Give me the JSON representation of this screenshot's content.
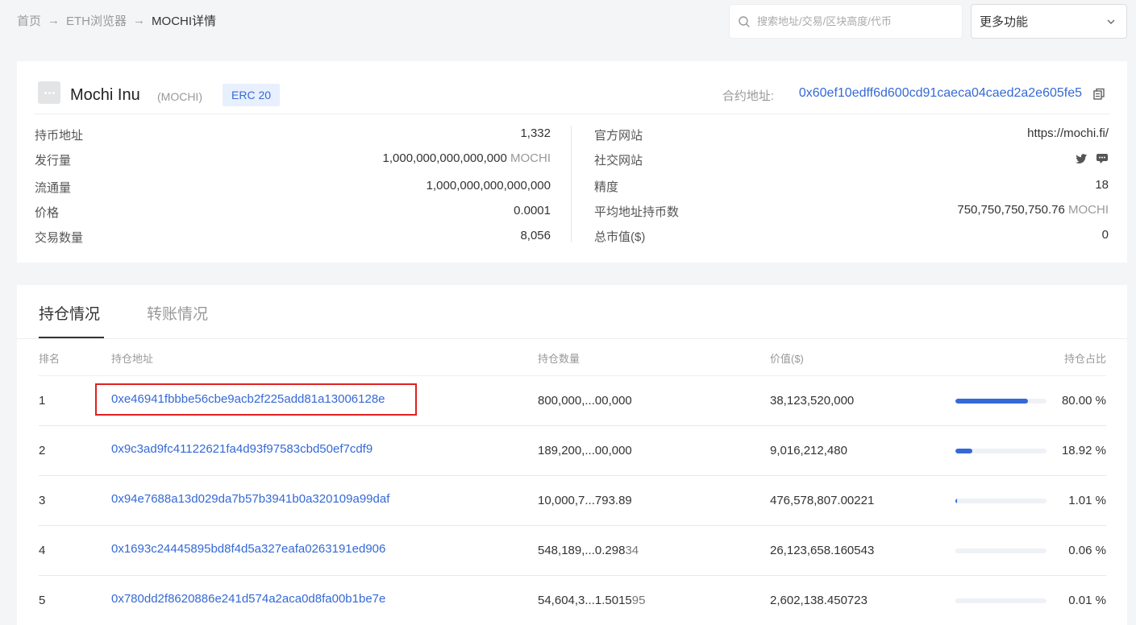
{
  "breadcrumb": {
    "home": "首页",
    "sep": "→",
    "explorer": "ETH浏览器",
    "current": "MOCHI详情"
  },
  "search": {
    "placeholder": "搜索地址/交易/区块高度/代币"
  },
  "more": {
    "label": "更多功能"
  },
  "token": {
    "name": "Mochi Inu",
    "symbol": "(MOCHI)",
    "standard": "ERC 20",
    "contract_label": "合约地址:",
    "contract_address": "0x60ef10edff6d600cd91caeca04caed2a2e605fe5"
  },
  "left_info": [
    {
      "label": "持币地址",
      "value": "1,332",
      "unit": ""
    },
    {
      "label": "发行量",
      "value": "1,000,000,000,000,000",
      "unit": " MOCHI"
    },
    {
      "label": "流通量",
      "value": "1,000,000,000,000,000",
      "unit": ""
    },
    {
      "label": "价格",
      "value": "0.0001",
      "unit": ""
    },
    {
      "label": "交易数量",
      "value": "8,056",
      "unit": ""
    }
  ],
  "right_info": [
    {
      "label": "官方网站",
      "value": "https://mochi.fi/",
      "unit": ""
    },
    {
      "label": "社交网站",
      "value": "",
      "unit": ""
    },
    {
      "label": "精度",
      "value": "18",
      "unit": ""
    },
    {
      "label": "平均地址持币数",
      "value": "750,750,750,750.76",
      "unit": " MOCHI"
    },
    {
      "label": "总市值($)",
      "value": "0",
      "unit": ""
    }
  ],
  "tabs": {
    "holdings": "持仓情况",
    "transfers": "转账情况"
  },
  "table": {
    "headers": {
      "rank": "排名",
      "address": "持仓地址",
      "amount": "持仓数量",
      "value": "价值($)",
      "share": "持仓占比"
    },
    "rows": [
      {
        "rank": "1",
        "address": "0xe46941fbbbe56cbe9acb2f225add81a13006128e",
        "amount_head": "800,000,...00,000",
        "amount_tail": "",
        "value": "38,123,520,000",
        "share": 0.8,
        "share_text": "80.00 %"
      },
      {
        "rank": "2",
        "address": "0x9c3ad9fc41122621fa4d93f97583cbd50ef7cdf9",
        "amount_head": "189,200,...00,000",
        "amount_tail": "",
        "value": "9,016,212,480",
        "share": 0.1892,
        "share_text": "18.92 %"
      },
      {
        "rank": "3",
        "address": "0x94e7688a13d029da7b57b3941b0a320109a99daf",
        "amount_head": "10,000,7...793.89",
        "amount_tail": "",
        "value": "476,578,807.00221",
        "share": 0.0101,
        "share_text": "1.01 %"
      },
      {
        "rank": "4",
        "address": "0x1693c24445895bd8f4d5a327eafa0263191ed906",
        "amount_head": "548,189,...0.298",
        "amount_tail": "34",
        "value": "26,123,658.160543",
        "share": 0.0006,
        "share_text": "0.06 %"
      },
      {
        "rank": "5",
        "address": "0x780dd2f8620886e241d574a2aca0d8fa00b1be7e",
        "amount_head": "54,604,3...1.5015",
        "amount_tail": "95",
        "value": "2,602,138.450723",
        "share": 0.0001,
        "share_text": "0.01 %"
      }
    ]
  },
  "colors": {
    "accent": "#3569d6",
    "highlight": "#e02020"
  }
}
